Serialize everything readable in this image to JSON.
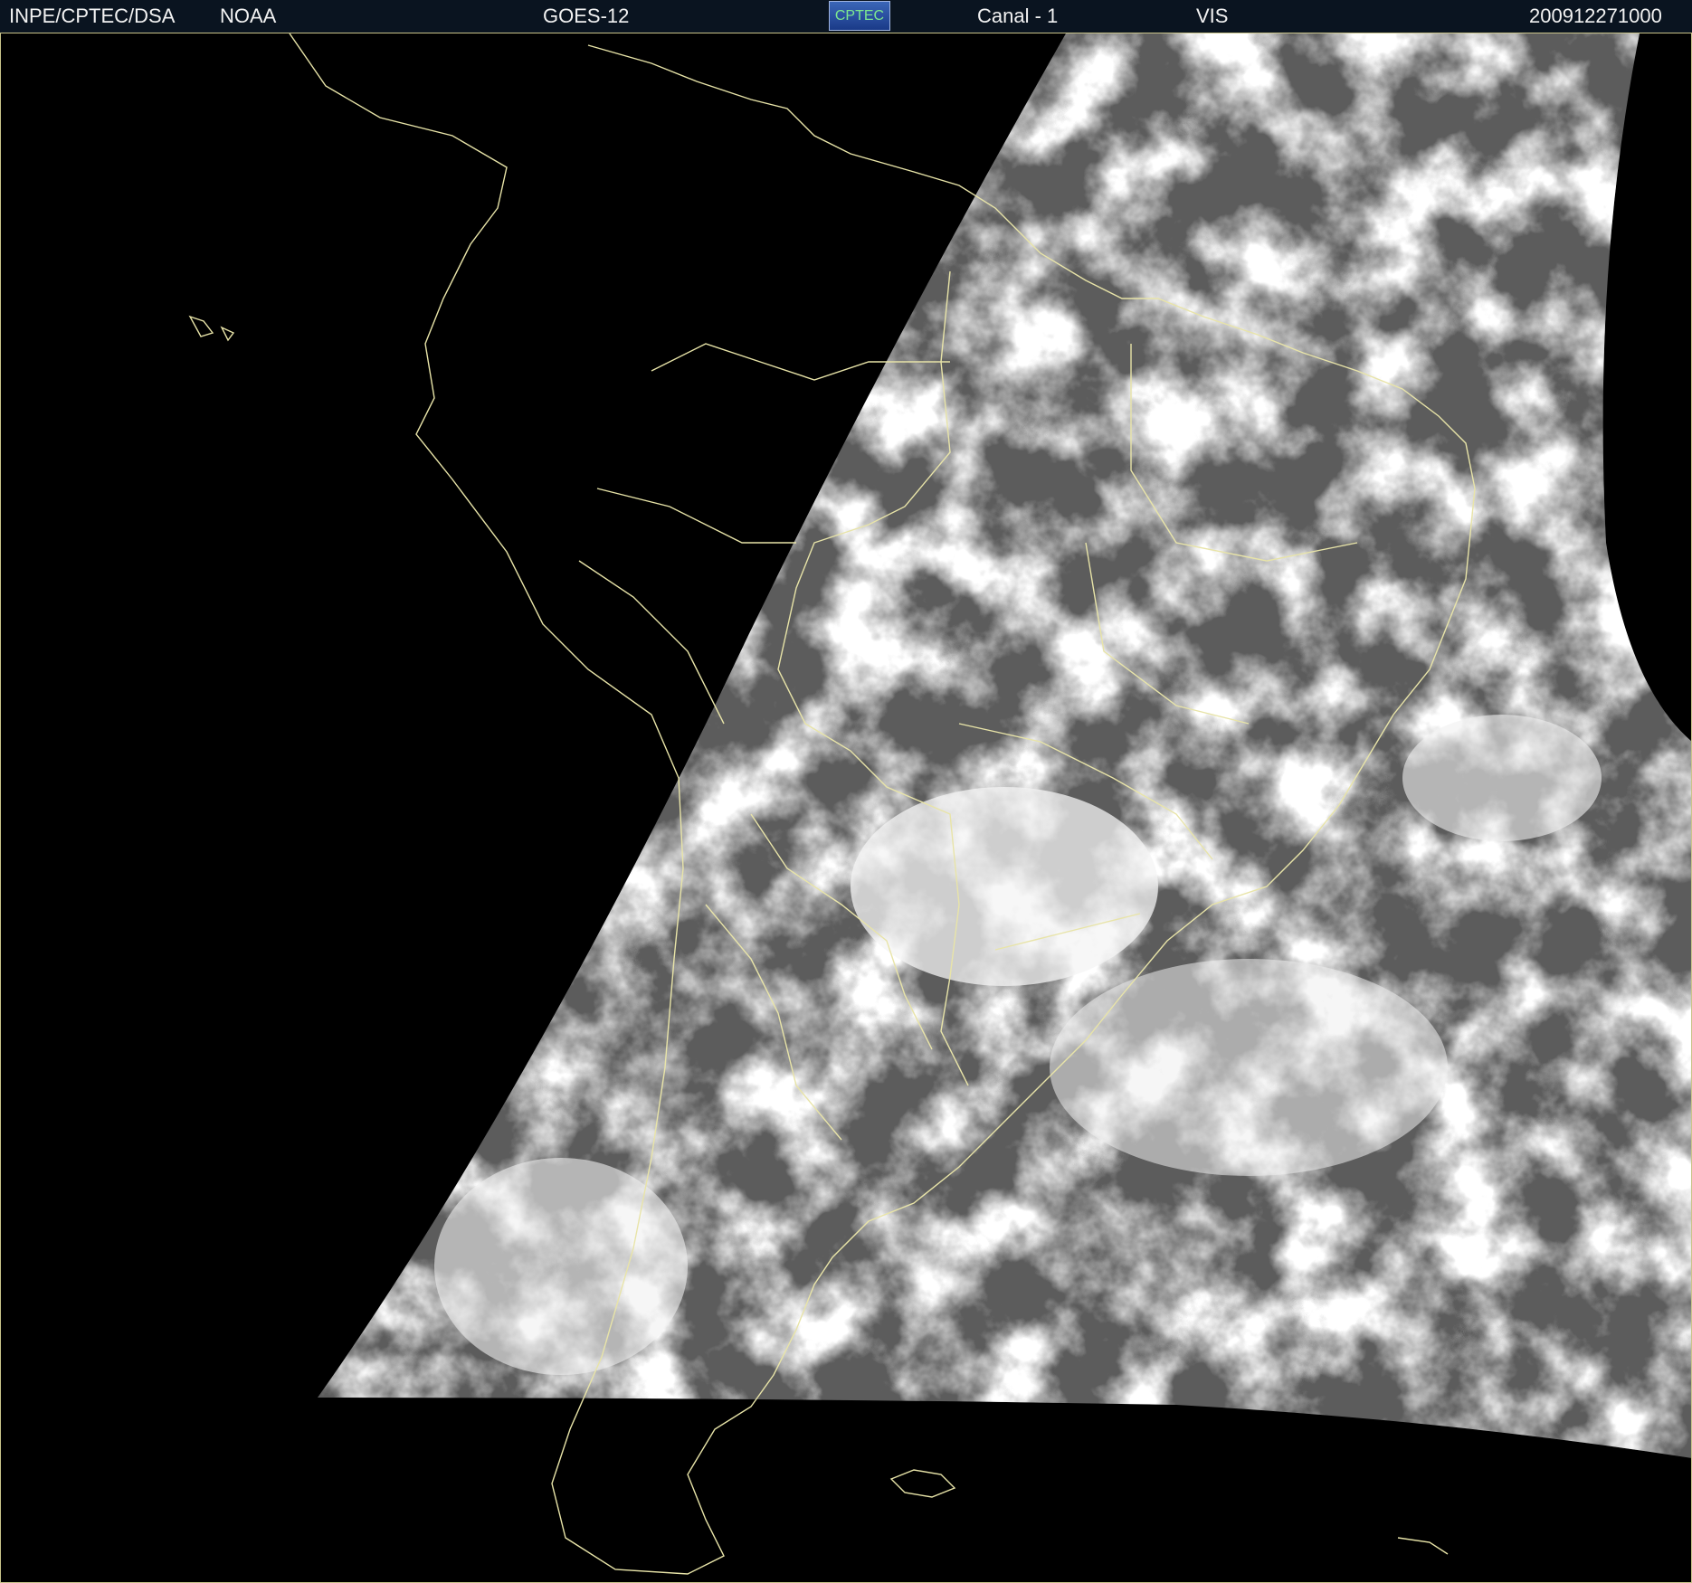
{
  "header": {
    "institution": "INPE/CPTEC/DSA",
    "agency": "NOAA",
    "satellite": "GOES-12",
    "logo_text": "CPTEC",
    "channel": "Canal - 1",
    "band": "VIS",
    "timestamp": "200912271000"
  },
  "map": {
    "image_type": "visible-satellite-image",
    "coverage": "south-america-atlantic",
    "colors": {
      "background": "#000000",
      "borders": "#e8e4a8",
      "frame": "#c9c48a"
    }
  }
}
